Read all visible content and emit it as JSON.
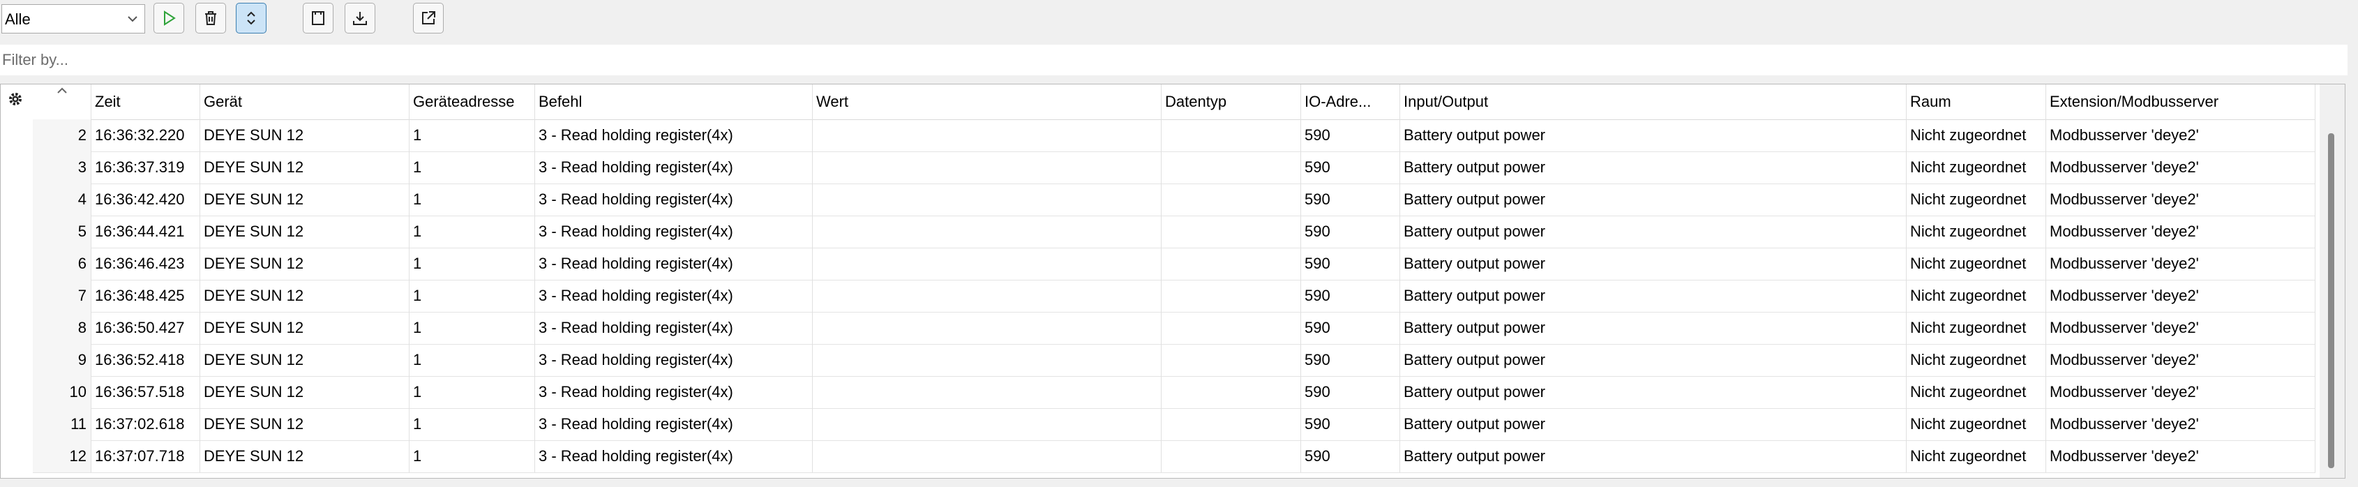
{
  "toolbar": {
    "filter_select": "Alle",
    "icons": [
      "chevron-down-icon",
      "play-icon",
      "trash-icon",
      "expand-collapse-icon",
      "document-icon",
      "download-icon",
      "open-external-icon"
    ]
  },
  "filter": {
    "placeholder": "Filter by..."
  },
  "table": {
    "columns": [
      "",
      "Zeit",
      "Gerät",
      "Geräteadresse",
      "Befehl",
      "Wert",
      "Datentyp",
      "IO-Adre...",
      "Input/Output",
      "Raum",
      "Extension/Modbusserver"
    ],
    "rows": [
      [
        "2",
        "16:36:32.220",
        "DEYE SUN 12",
        "1",
        "3 - Read holding register(4x)",
        "",
        "",
        "590",
        "Battery output power",
        "Nicht zugeordnet",
        "Modbusserver 'deye2'"
      ],
      [
        "3",
        "16:36:37.319",
        "DEYE SUN 12",
        "1",
        "3 - Read holding register(4x)",
        "",
        "",
        "590",
        "Battery output power",
        "Nicht zugeordnet",
        "Modbusserver 'deye2'"
      ],
      [
        "4",
        "16:36:42.420",
        "DEYE SUN 12",
        "1",
        "3 - Read holding register(4x)",
        "",
        "",
        "590",
        "Battery output power",
        "Nicht zugeordnet",
        "Modbusserver 'deye2'"
      ],
      [
        "5",
        "16:36:44.421",
        "DEYE SUN 12",
        "1",
        "3 - Read holding register(4x)",
        "",
        "",
        "590",
        "Battery output power",
        "Nicht zugeordnet",
        "Modbusserver 'deye2'"
      ],
      [
        "6",
        "16:36:46.423",
        "DEYE SUN 12",
        "1",
        "3 - Read holding register(4x)",
        "",
        "",
        "590",
        "Battery output power",
        "Nicht zugeordnet",
        "Modbusserver 'deye2'"
      ],
      [
        "7",
        "16:36:48.425",
        "DEYE SUN 12",
        "1",
        "3 - Read holding register(4x)",
        "",
        "",
        "590",
        "Battery output power",
        "Nicht zugeordnet",
        "Modbusserver 'deye2'"
      ],
      [
        "8",
        "16:36:50.427",
        "DEYE SUN 12",
        "1",
        "3 - Read holding register(4x)",
        "",
        "",
        "590",
        "Battery output power",
        "Nicht zugeordnet",
        "Modbusserver 'deye2'"
      ],
      [
        "9",
        "16:36:52.418",
        "DEYE SUN 12",
        "1",
        "3 - Read holding register(4x)",
        "",
        "",
        "590",
        "Battery output power",
        "Nicht zugeordnet",
        "Modbusserver 'deye2'"
      ],
      [
        "10",
        "16:36:57.518",
        "DEYE SUN 12",
        "1",
        "3 - Read holding register(4x)",
        "",
        "",
        "590",
        "Battery output power",
        "Nicht zugeordnet",
        "Modbusserver 'deye2'"
      ],
      [
        "11",
        "16:37:02.618",
        "DEYE SUN 12",
        "1",
        "3 - Read holding register(4x)",
        "",
        "",
        "590",
        "Battery output power",
        "Nicht zugeordnet",
        "Modbusserver 'deye2'"
      ],
      [
        "12",
        "16:37:07.718",
        "DEYE SUN 12",
        "1",
        "3 - Read holding register(4x)",
        "",
        "",
        "590",
        "Battery output power",
        "Nicht zugeordnet",
        "Modbusserver 'deye2'"
      ]
    ]
  }
}
